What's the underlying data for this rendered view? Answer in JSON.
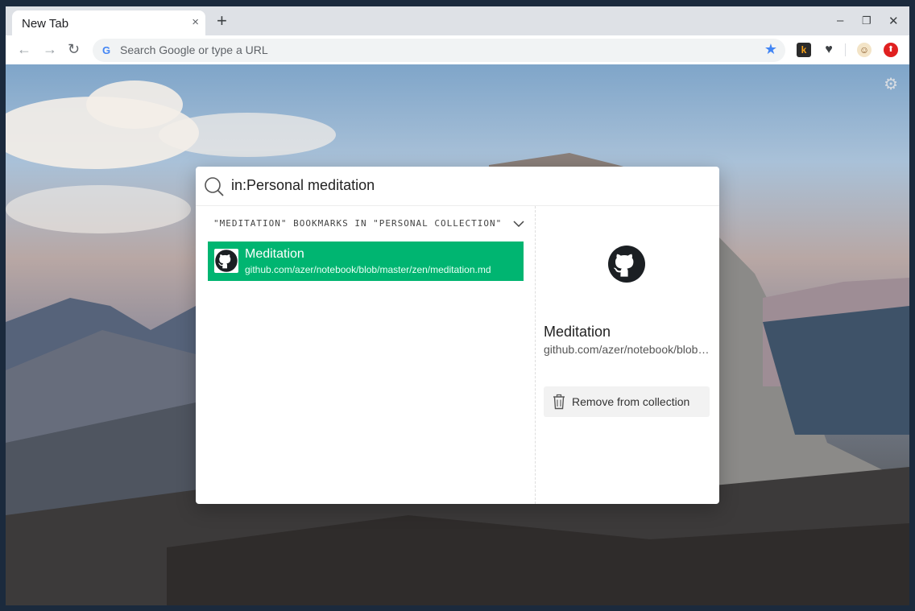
{
  "browser": {
    "tab_title": "New Tab",
    "tab_close": "×",
    "new_tab": "+",
    "minimize": "–",
    "restore": "❐",
    "close": "✕",
    "omnibox_placeholder": "Search Google or type a URL",
    "accent": "#4285f4"
  },
  "extensions": [
    {
      "name": "k-extension-icon",
      "glyph": "k"
    },
    {
      "name": "heart-extension-icon",
      "glyph": "♥"
    },
    {
      "name": "avatar-extension-icon",
      "glyph": "☺"
    },
    {
      "name": "upload-extension-icon",
      "glyph": "⬆"
    }
  ],
  "search": {
    "query": "in:Personal meditation"
  },
  "results": {
    "section_label": "\"MEDITATION\" BOOKMARKS IN \"PERSONAL COLLECTION\"",
    "items": [
      {
        "title": "Meditation",
        "url": "github.com/azer/notebook/blob/master/zen/meditation.md"
      }
    ],
    "selected_color": "#00b571"
  },
  "detail": {
    "title": "Meditation",
    "url": "github.com/azer/notebook/blob/master/zen/meditation.md",
    "remove_label": "Remove from collection"
  }
}
